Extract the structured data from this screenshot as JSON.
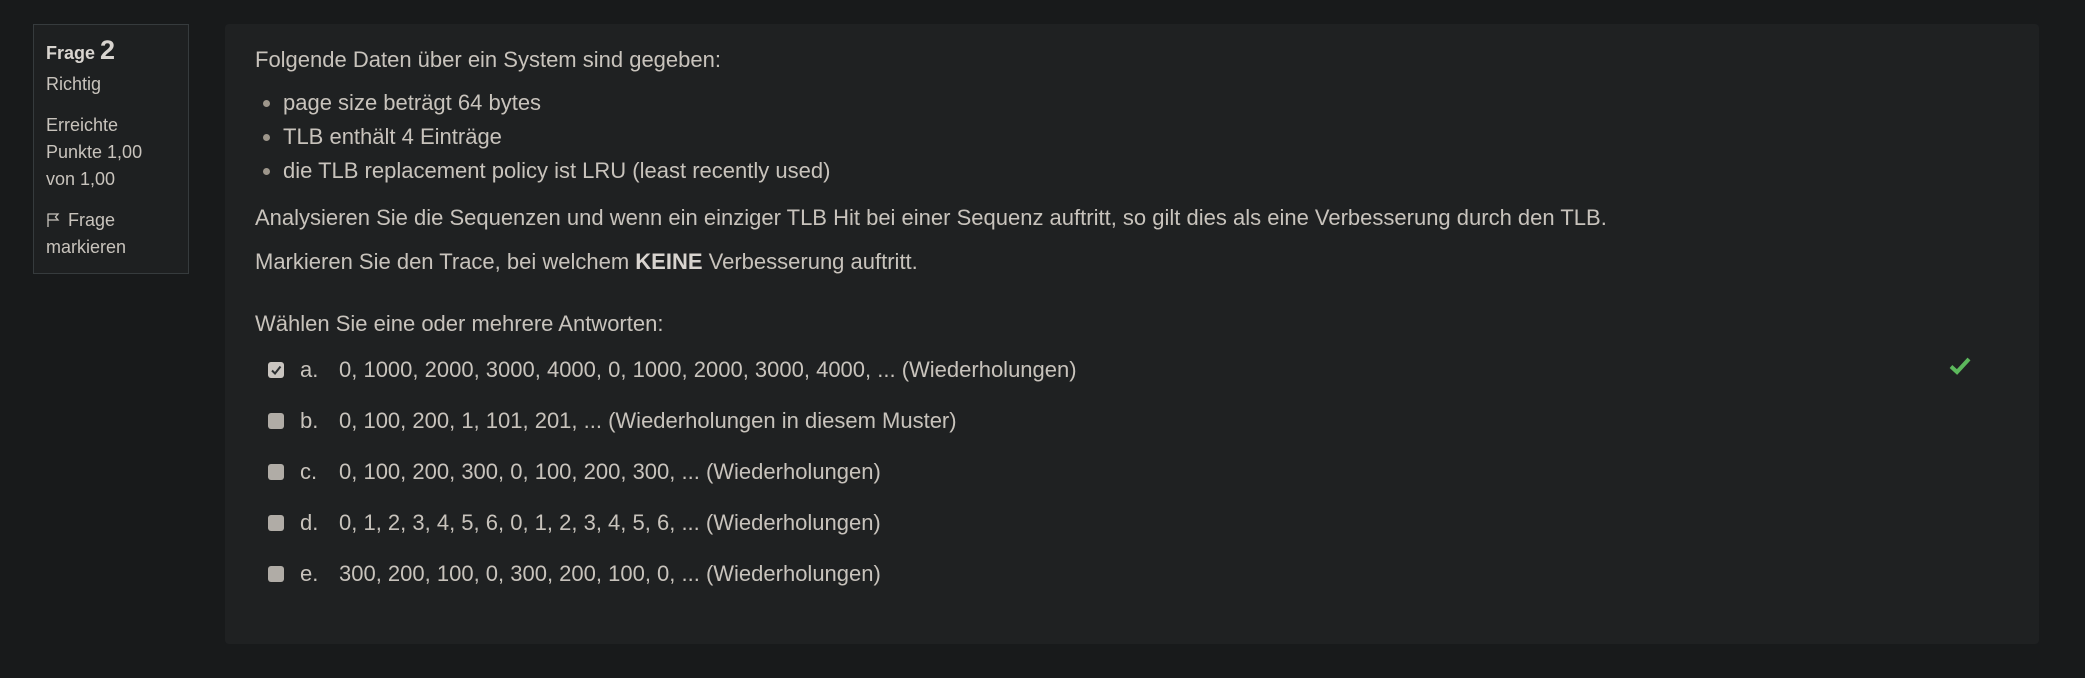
{
  "question_info": {
    "label": "Frage",
    "number": "2",
    "state": "Richtig",
    "grade": "Erreichte Punkte 1,00 von 1,00",
    "flag_label": "Frage markieren"
  },
  "question": {
    "intro": "Folgende Daten über ein System sind gegeben:",
    "facts": [
      "page size beträgt 64 bytes",
      "TLB enthält 4 Einträge",
      "die TLB replacement policy ist LRU (least recently used)"
    ],
    "paragraph1": "Analysieren Sie die Sequenzen und wenn ein einziger TLB Hit bei einer Sequenz auftritt, so gilt dies als eine Verbesserung durch den TLB.",
    "paragraph2_pre": "Markieren Sie den Trace, bei welchem ",
    "paragraph2_bold": "KEINE",
    "paragraph2_post": " Verbesserung auftritt.",
    "prompt": "Wählen Sie eine oder mehrere Antworten:",
    "answers": [
      {
        "letter": "a.",
        "text": "0, 1000, 2000, 3000, 4000, 0, 1000, 2000, 3000, 4000, ... (Wiederholungen)",
        "checked": true,
        "correct": true
      },
      {
        "letter": "b.",
        "text": "0, 100, 200, 1, 101, 201, ... (Wiederholungen in diesem Muster)",
        "checked": false
      },
      {
        "letter": "c.",
        "text": "0, 100, 200, 300, 0, 100, 200, 300, ... (Wiederholungen)",
        "checked": false
      },
      {
        "letter": "d.",
        "text": "0, 1, 2, 3, 4, 5, 6, 0, 1, 2, 3, 4, 5, 6, ... (Wiederholungen)",
        "checked": false
      },
      {
        "letter": "e.",
        "text": "300, 200, 100, 0, 300, 200, 100, 0, ... (Wiederholungen)",
        "checked": false
      }
    ]
  },
  "colors": {
    "page_bg": "#181a1b",
    "panel_bg": "#1f2122",
    "text": "#c8c3bc",
    "correct_green": "#5cb85c"
  },
  "icons": {
    "flag": "flag-icon",
    "check": "check-icon"
  }
}
